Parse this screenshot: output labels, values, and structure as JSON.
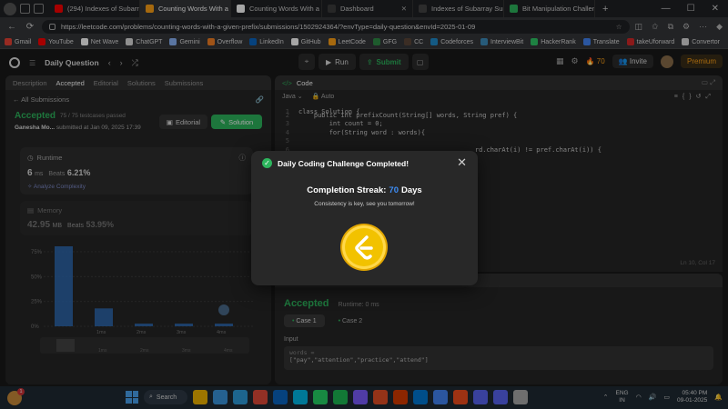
{
  "browser": {
    "tabs": [
      {
        "label": "(294) Indexes of Subarray",
        "color": "#ff0000",
        "active": false
      },
      {
        "label": "Counting Words With a G",
        "color": "#ffa116",
        "active": true
      },
      {
        "label": "Counting Words With a G",
        "color": "#ffffff",
        "active": false
      },
      {
        "label": "Dashboard",
        "color": "#3c3c3c",
        "active": false
      },
      {
        "label": "Indexes of Subarray Sum",
        "color": "#444444",
        "active": false
      },
      {
        "label": "Bit Manipulation Challen",
        "color": "#2db55d",
        "active": false
      }
    ],
    "url": "https://leetcode.com/problems/counting-words-with-a-given-prefix/submissions/1502924364/?envType=daily-question&envId=2025-01-09",
    "bookmarks": [
      {
        "label": "Gmail",
        "color": "#ea4335"
      },
      {
        "label": "YouTube",
        "color": "#ff0000"
      },
      {
        "label": "Net Wave",
        "color": "#ffffff"
      },
      {
        "label": "ChatGPT",
        "color": "#dddddd"
      },
      {
        "label": "Gemini",
        "color": "#8ab4f8"
      },
      {
        "label": "Overflow",
        "color": "#f48024"
      },
      {
        "label": "LinkedIn",
        "color": "#0a66c2"
      },
      {
        "label": "GitHub",
        "color": "#ffffff"
      },
      {
        "label": "LeetCode",
        "color": "#ffa116"
      },
      {
        "label": "GFG",
        "color": "#2f8d46"
      },
      {
        "label": "CC",
        "color": "#5b4638"
      },
      {
        "label": "Codeforces",
        "color": "#1f8acb"
      },
      {
        "label": "InterviewBit",
        "color": "#3c8dbc"
      },
      {
        "label": "HackerRank",
        "color": "#2ec866"
      },
      {
        "label": "Translate",
        "color": "#4285f4"
      },
      {
        "label": "takeUforward",
        "color": "#d62828"
      },
      {
        "label": "Convertor",
        "color": "#dddddd"
      }
    ]
  },
  "leetcode": {
    "top_title": "Daily Question",
    "run_label": "Run",
    "submit_label": "Submit",
    "streak_count": "70",
    "invite_label": "Invite",
    "premium_label": "Premium",
    "left_tabs": [
      "Description",
      "Accepted",
      "Editorial",
      "Solutions",
      "Submissions"
    ],
    "all_submissions": "All Submissions",
    "accepted": "Accepted",
    "testcases": "75 / 75 testcases passed",
    "editorial_btn": "Editorial",
    "solution_btn": "Solution",
    "author": "Ganesha Mo...",
    "submitted": "submitted at Jan 09, 2025 17:39",
    "runtime_label": "Runtime",
    "runtime_value": "6",
    "runtime_unit": "ms",
    "runtime_beats": "Beats",
    "runtime_pct": "6.21%",
    "analyze": "Analyze Complexity",
    "memory_label": "Memory",
    "memory_value": "42.95",
    "memory_unit": "MB",
    "memory_beats": "Beats",
    "memory_pct": "53.95%",
    "code_title": "Code",
    "lang": "Java",
    "auto": "Auto",
    "code_lines": [
      "class Solution {",
      "    public int prefixCount(String[] words, String pref) {",
      "        int count = 0;",
      "        for(String word : words){",
      "",
      "                                              rd.charAt(i) != pref.charAt(i)) {"
    ],
    "cursor_pos": "Ln 10, Col 17",
    "result_tabs": [
      "Test Result",
      "Testcase"
    ],
    "result_accepted": "Accepted",
    "result_runtime": "Runtime: 0 ms",
    "cases": [
      "Case 1",
      "Case 2"
    ],
    "input_label": "Input",
    "input_key": "words =",
    "input_value": "[\"pay\",\"attention\",\"practice\",\"attend\"]"
  },
  "modal": {
    "title": "Daily Coding Challenge Completed!",
    "streak_prefix": "Completion Streak:",
    "streak_number": "70",
    "streak_suffix": "Days",
    "message": "Consistency is key, see you tomorrow!"
  },
  "chart_data": {
    "type": "bar",
    "categories": [
      "",
      "1ms",
      "2ms",
      "3ms",
      "4ms"
    ],
    "values": [
      92,
      20,
      3,
      3,
      3
    ],
    "y_ticks": [
      "75%",
      "50%",
      "25%",
      "0%"
    ],
    "x_ticks": [
      "1ms",
      "2ms",
      "3ms",
      "4ms"
    ],
    "ylim": [
      0,
      100
    ],
    "bar_color": "#2f6fba"
  },
  "taskbar": {
    "search": "Search",
    "badge": "1",
    "lang_top": "ENG",
    "lang_bottom": "IN",
    "time": "05:40 PM",
    "date": "09-01-2025",
    "apps": [
      "#f0b400",
      "#3a96dd",
      "#2d9cdb",
      "#e04b3a",
      "#0a66c2",
      "#00b9e8",
      "#25d366",
      "#1db954",
      "#7c5cff",
      "#e34f26",
      "#d83b01",
      "#0078d4",
      "#4285f4",
      "#f24e1e",
      "#5865f2",
      "#5865f2",
      "#aaaaaa"
    ]
  }
}
